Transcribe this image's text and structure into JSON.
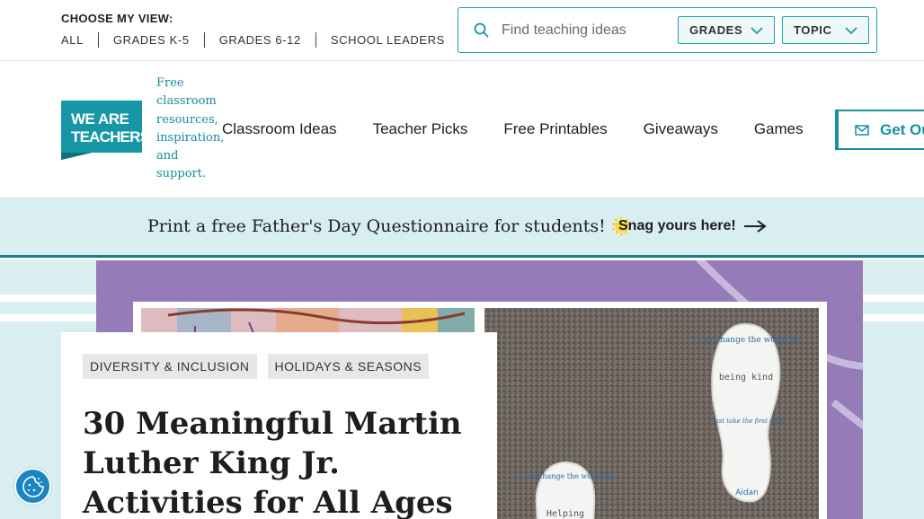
{
  "view_selector": {
    "label": "CHOOSE MY VIEW:",
    "options": [
      "ALL",
      "GRADES K-5",
      "GRADES 6-12",
      "SCHOOL LEADERS"
    ]
  },
  "search": {
    "placeholder": "Find teaching ideas",
    "grades_label": "GRADES",
    "topic_label": "TOPIC"
  },
  "brand": {
    "logo_line1": "WE ARE",
    "logo_line2": "TEACHERS",
    "tagline": "Free classroom resources, inspiration, and support.",
    "color": "#1797a6"
  },
  "nav": {
    "items": [
      "Classroom Ideas",
      "Teacher Picks",
      "Free Printables",
      "Giveaways",
      "Games"
    ],
    "cta_label": "Get Our"
  },
  "promo": {
    "text": "Print a free Father's Day Questionnaire for students! 🌟",
    "link_label": "Snag yours here!"
  },
  "article": {
    "tags": [
      "DIVERSITY & INCLUSION",
      "HOLIDAYS & SEASONS"
    ],
    "title": "30 Meaningful Martin Luther King Jr. Activities for All Ages"
  },
  "photo": {
    "footprint_text_1": "I can change the world by",
    "footprint_text_2": "being kind",
    "footprint_text_3": "Just take the first step.",
    "footprint_name": "Aidan",
    "footprint_small_1": "I can change the world by",
    "footprint_small_2": "Helping"
  },
  "icons": {
    "search": "search-icon",
    "chevron": "chevron-down-icon",
    "mail": "mail-icon",
    "arrow": "arrow-right-icon",
    "cookie": "cookie-settings-icon"
  },
  "colors": {
    "teal": "#1797a6",
    "banner_bg": "#d8eef1",
    "hero_purple": "#957bb8"
  }
}
